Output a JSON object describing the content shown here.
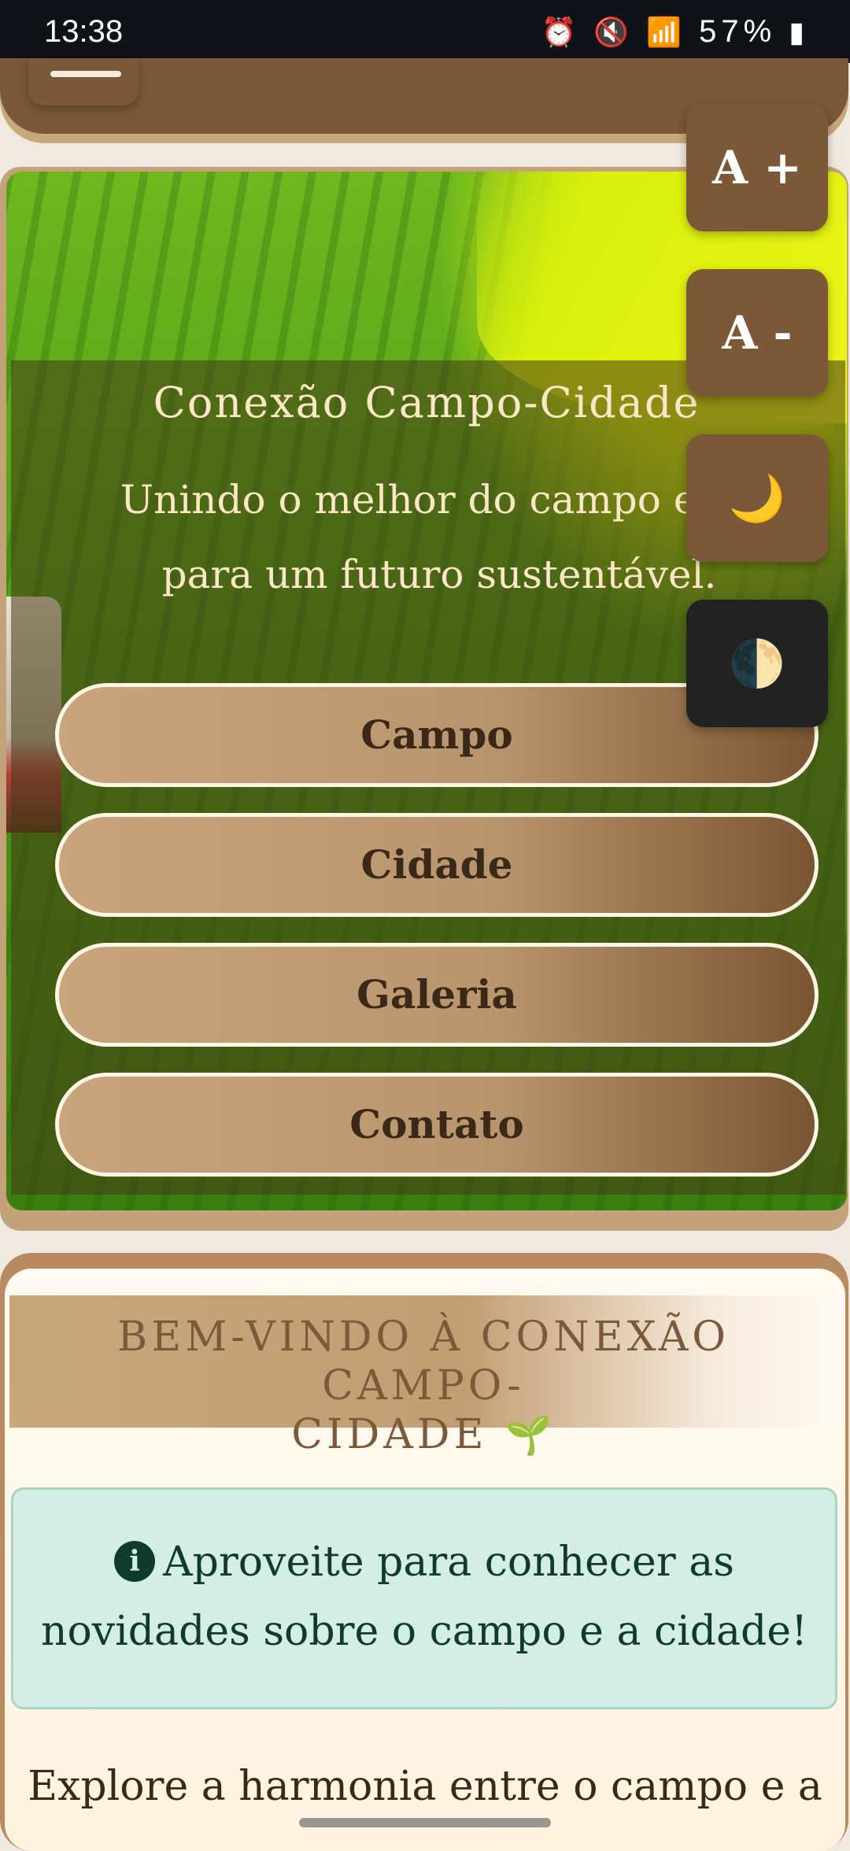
{
  "status_bar": {
    "time": "13:38",
    "icons": [
      "alarm-icon",
      "mute-icon",
      "wifi-icon",
      "signal-icon"
    ],
    "battery": "57%"
  },
  "hero": {
    "title": "Conexão Campo-Cidade",
    "subtitle_line1": "Unindo o melhor do campo e da",
    "subtitle_line2": "para um futuro sustentável.",
    "nav": [
      {
        "label": "Campo"
      },
      {
        "label": "Cidade"
      },
      {
        "label": "Galeria"
      },
      {
        "label": "Contato"
      }
    ]
  },
  "controls": {
    "font_increase": "A +",
    "font_decrease": "A -",
    "moon_icon": "🌙",
    "theme_icon": "🌓"
  },
  "welcome": {
    "title_line1": "BEM-VINDO À CONEXÃO CAMPO-",
    "title_line2": "CIDADE",
    "sprout": "🌱",
    "info_icon": "i",
    "info_line1": "Aproveite para conhecer as",
    "info_line2": "novidades sobre o campo e a cidade!",
    "explore": "Explore a harmonia entre o campo e a"
  },
  "colors": {
    "brown": "#7a5838",
    "tan": "#c4a37b",
    "info_bg": "#d4eee5",
    "info_text": "#0e3b2c"
  }
}
